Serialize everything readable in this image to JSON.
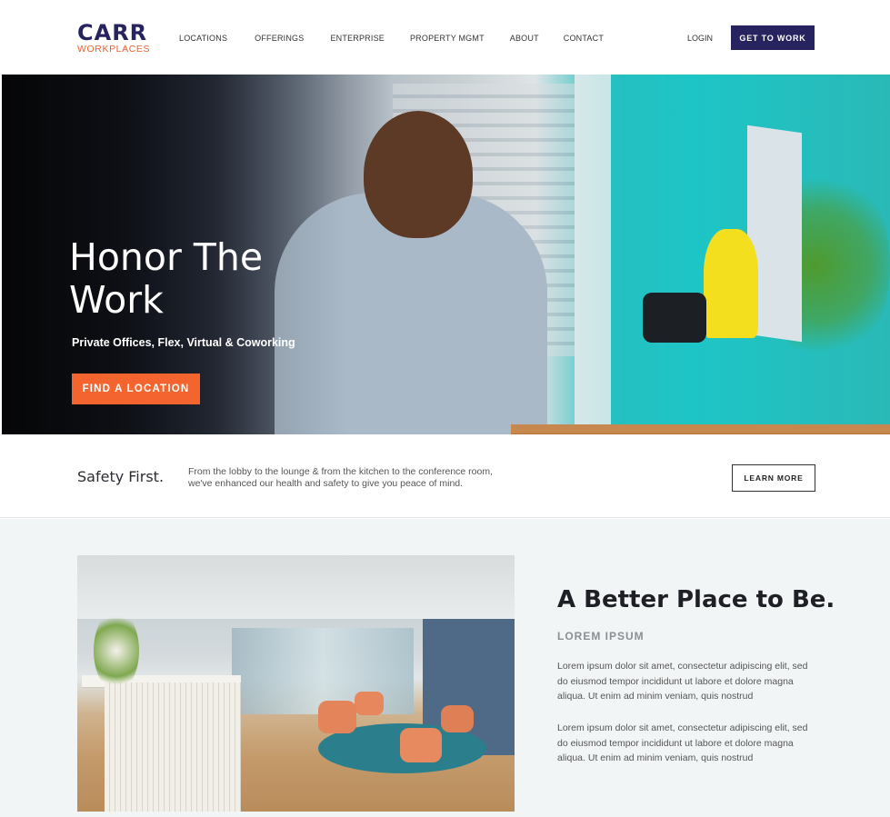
{
  "brand": {
    "name": "CARR",
    "sub": "WORKPLACES",
    "colors": {
      "navy": "#27235e",
      "orange": "#f4642f",
      "light_bg": "#f2f5f6"
    }
  },
  "nav": {
    "items": [
      "LOCATIONS",
      "OFFERINGS",
      "ENTERPRISE",
      "PROPERTY MGMT",
      "ABOUT",
      "CONTACT"
    ],
    "login": "LOGIN",
    "cta": "GET TO WORK"
  },
  "hero": {
    "title": "Honor The Work",
    "subtitle": "Private Offices, Flex, Virtual & Coworking",
    "button": "FIND A LOCATION"
  },
  "safety": {
    "title": "Safety First.",
    "text": "From the lobby to the lounge & from the kitchen to the conference room, we've enhanced our health and safety to give you peace of mind.",
    "button": "LEARN MORE"
  },
  "feature": {
    "title": "A Better Place to Be.",
    "kicker": "LOREM IPSUM",
    "paragraphs": [
      "Lorem ipsum dolor sit amet, consectetur adipiscing elit, sed do eiusmod tempor incididunt ut labore et dolore magna aliqua. Ut enim ad minim veniam, quis nostrud",
      "Lorem ipsum dolor sit amet, consectetur adipiscing elit, sed do eiusmod tempor incididunt ut labore et dolore magna aliqua. Ut enim ad minim veniam, quis nostrud"
    ]
  }
}
